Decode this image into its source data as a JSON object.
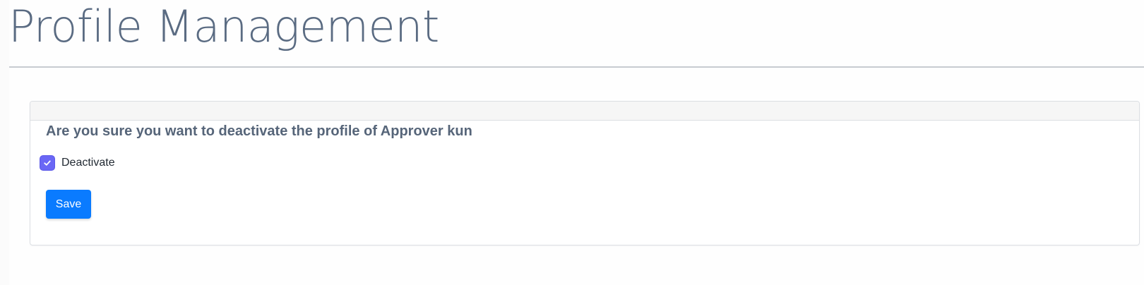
{
  "page": {
    "title": "Profile Management"
  },
  "form": {
    "question": "Are you sure you want to deactivate the profile of Approver kun",
    "deactivate_label": "Deactivate",
    "deactivate_checked": true,
    "save_label": "Save"
  },
  "colors": {
    "title_text": "#5a6b82",
    "checkbox_fill": "#6a67f5",
    "save_button": "#0a7bff"
  },
  "icons": {
    "checkbox_mark": "checkmark-icon"
  }
}
